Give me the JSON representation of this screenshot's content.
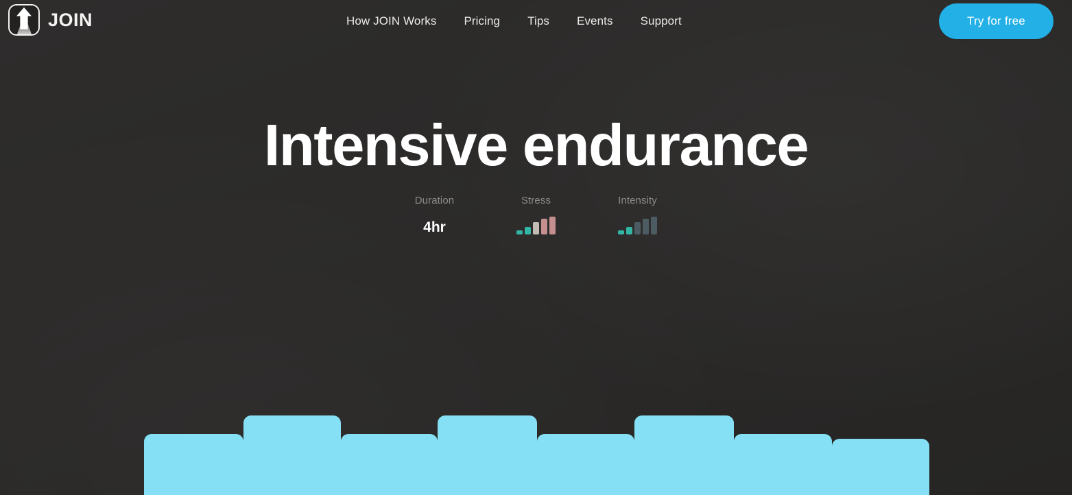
{
  "header": {
    "brand_name": "JOIN",
    "logo_icon": "up-arrow-road-logo",
    "nav": [
      {
        "label": "How JOIN Works"
      },
      {
        "label": "Pricing"
      },
      {
        "label": "Tips"
      },
      {
        "label": "Events"
      },
      {
        "label": "Support"
      }
    ],
    "cta_label": "Try for free",
    "cta_color": "#22b0e6"
  },
  "hero": {
    "title": "Intensive endurance"
  },
  "stats": [
    {
      "label": "Duration",
      "type": "text",
      "value": "4hr"
    },
    {
      "label": "Stress",
      "type": "bars",
      "value": ""
    },
    {
      "label": "Intensity",
      "type": "bars",
      "value": ""
    }
  ],
  "chart_data": [
    {
      "type": "bar",
      "title": "Stress",
      "categories": [
        "1",
        "2",
        "3",
        "4",
        "5"
      ],
      "values": [
        6,
        11,
        18,
        23,
        26
      ],
      "colors": [
        "#33b5a6",
        "#33b5a6",
        "#c2bcb4",
        "#c58f90",
        "#c58f90"
      ],
      "ylabel": "",
      "xlabel": "",
      "ylim": [
        0,
        26
      ],
      "grid": false,
      "legend": "none"
    },
    {
      "type": "bar",
      "title": "Intensity",
      "categories": [
        "1",
        "2",
        "3",
        "4",
        "5"
      ],
      "values": [
        6,
        11,
        18,
        23,
        26
      ],
      "colors": [
        "#33b5a6",
        "#33b5a6",
        "#4d5c63",
        "#4d5c63",
        "#4d5c63"
      ],
      "ylabel": "",
      "xlabel": "",
      "ylim": [
        0,
        26
      ],
      "grid": false,
      "legend": "none"
    },
    {
      "type": "bar",
      "title": "Workout power profile",
      "categories": [
        "1",
        "2",
        "3",
        "4",
        "5",
        "6",
        "7",
        "8"
      ],
      "values": [
        73,
        95,
        73,
        95,
        73,
        95,
        73,
        67
      ],
      "widths": [
        145,
        142,
        141,
        145,
        142,
        145,
        143,
        142
      ],
      "color": "#85e0f5",
      "ylabel": "",
      "xlabel": "",
      "ylim": [
        0,
        100
      ],
      "grid": false,
      "legend": "none"
    }
  ]
}
